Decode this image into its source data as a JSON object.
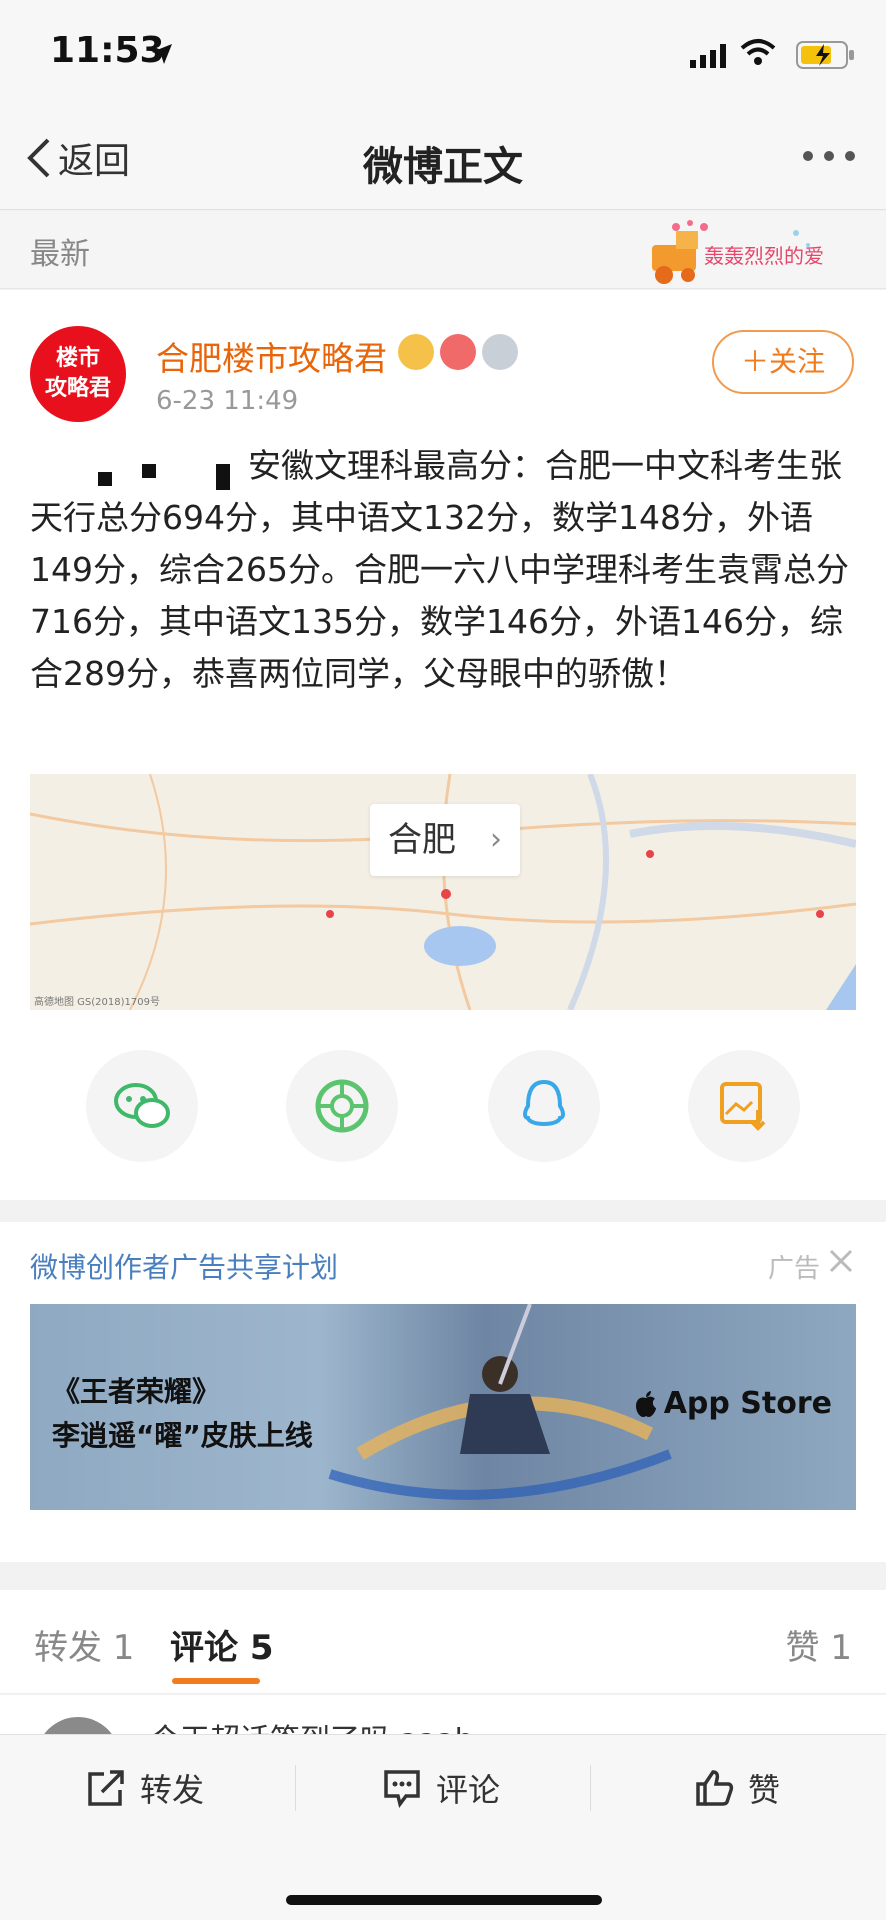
{
  "status_bar": {
    "time": "11:53"
  },
  "nav": {
    "back_label": "返回",
    "title": "微博正文"
  },
  "latest": {
    "label": "最新",
    "banner_text": "轰轰烈烈的爱"
  },
  "post": {
    "avatar_line1": "楼市",
    "avatar_line2": "攻略君",
    "author": "合肥楼市攻略君",
    "time": "6-23 11:49",
    "follow_label": "＋关注",
    "content": "安徽文理科最高分：合肥一中文科考生张天行总分694分，其中语文132分，数学148分，外语149分，综合265分。合肥一六八中学理科考生袁霄总分716分，其中语文135分，数学146分，外语146分，综合289分，恭喜两位同学，父母眼中的骄傲！",
    "location": "合肥",
    "map_footer": "高德地图 GS(2018)1709号"
  },
  "ad": {
    "title": "微博创作者广告共享计划",
    "tag": "广告",
    "line1": "《王者荣耀》",
    "line2": "李逍遥“曜”皮肤上线",
    "store": "App Store"
  },
  "tabs": {
    "repost": "转发 1",
    "comment": "评论 5",
    "like": "赞 1"
  },
  "comment_preview": "今天超话签到了吗 aaah",
  "toolbar": {
    "repost": "转发",
    "comment": "评论",
    "like": "赞"
  },
  "colors": {
    "accent": "#f07c1e",
    "author": "#e8650a",
    "link_blue": "#4a7fbf"
  }
}
